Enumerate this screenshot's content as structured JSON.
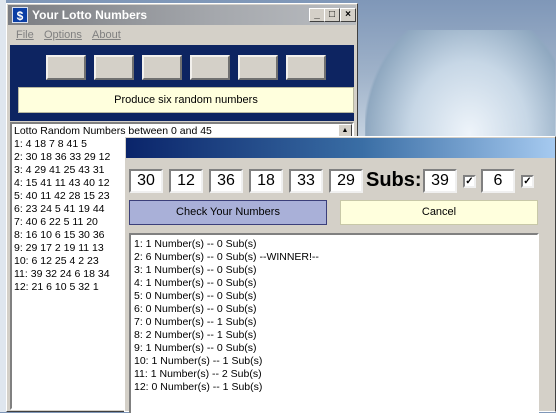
{
  "lotto_window": {
    "title": "Your Lotto Numbers",
    "app_icon": "$",
    "caption_buttons": [
      "_",
      "□",
      "×"
    ],
    "menu": [
      "File",
      "Options",
      "About"
    ],
    "number_slots": [
      "",
      "",
      "",
      "",
      "",
      ""
    ],
    "produce_button": "Produce six random numbers",
    "list_text": "Lotto Random Numbers between 0 and 45\n1: 4 18 7 8 41 5\n2: 30 18 36 33 29 12\n3: 4 29 41 25 43 31\n4: 15 41 11 43 40 12\n5: 40 11 42 28 15 23\n6: 23 24 5 41 19 44\n7: 40 6 22 5 11 20\n8: 16 10 6 15 30 36\n9: 29 17 2 19 11 13\n10: 6 12 25 4 2 23\n11: 39 32 24 6 18 34\n12: 21 6 10 5 32 1"
  },
  "checker_window": {
    "numbers": [
      "30",
      "12",
      "36",
      "18",
      "33",
      "29"
    ],
    "subs_label": "Subs:",
    "sub_1": "39",
    "sub_1_checked": true,
    "sub_2": "6",
    "sub_2_checked": true,
    "check_button": "Check Your Numbers",
    "cancel_button": "Cancel",
    "results_text": "1: 1 Number(s) -- 0 Sub(s)\n2: 6 Number(s) -- 0 Sub(s) --WINNER!--\n3: 1 Number(s) -- 0 Sub(s)\n4: 1 Number(s) -- 0 Sub(s)\n5: 0 Number(s) -- 0 Sub(s)\n6: 0 Number(s) -- 0 Sub(s)\n7: 0 Number(s) -- 1 Sub(s)\n8: 2 Number(s) -- 1 Sub(s)\n9: 1 Number(s) -- 0 Sub(s)\n10: 1 Number(s) -- 1 Sub(s)\n11: 1 Number(s) -- 2 Sub(s)\n12: 0 Number(s) -- 1 Sub(s)"
  },
  "colors": {
    "blue_panel": "#0d2461",
    "produce_button_bg": "#ffffdd",
    "check_button_bg": "#a9b0d8"
  },
  "icons": {
    "scroll_up": "▲",
    "check_mark": "✓"
  }
}
